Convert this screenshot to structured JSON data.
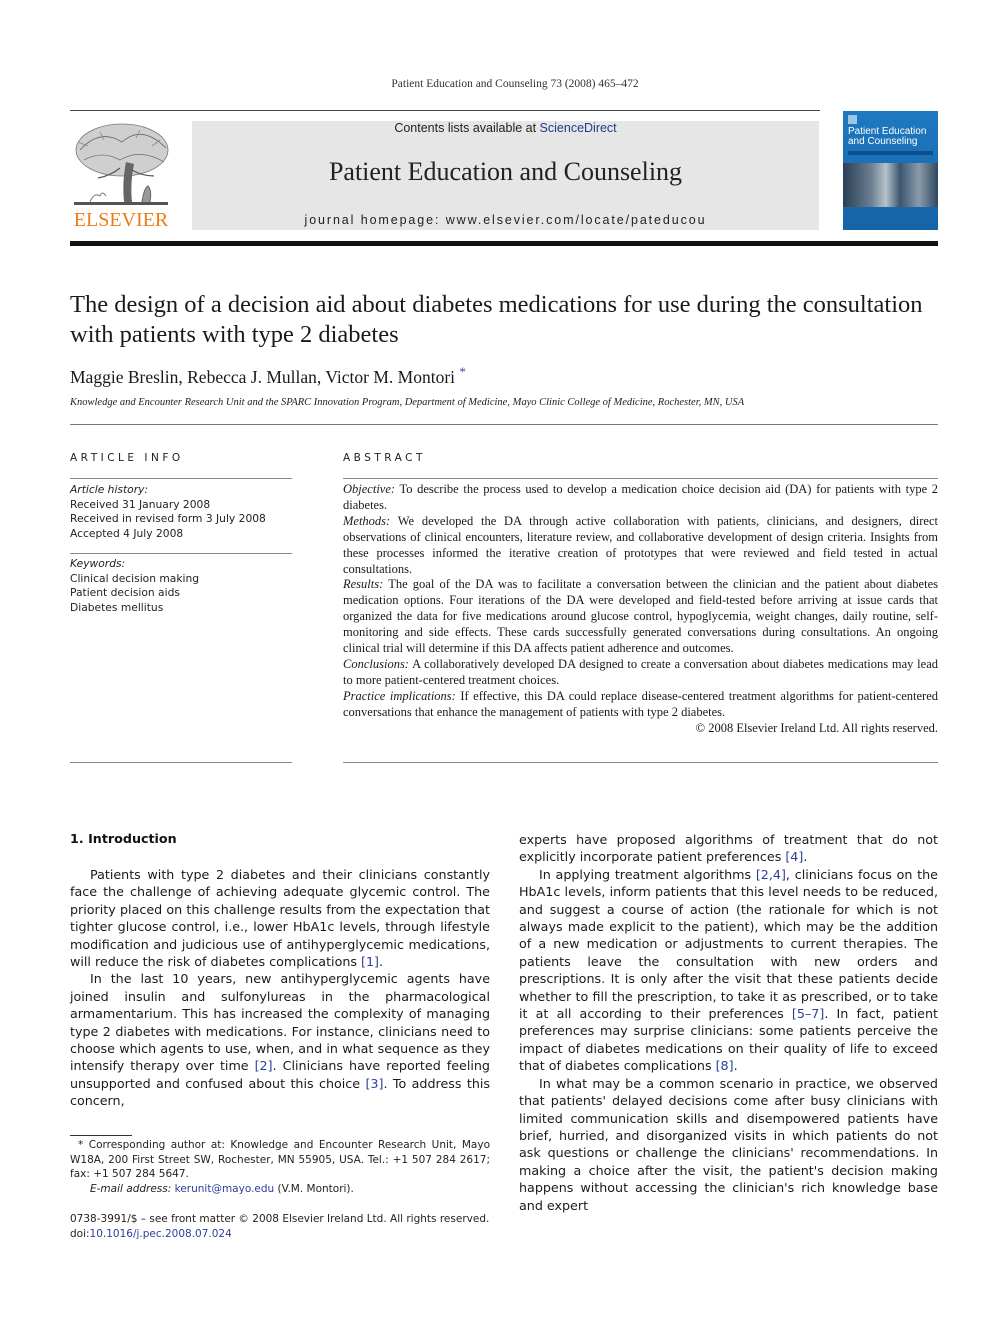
{
  "running_head": "Patient Education and Counseling 73 (2008) 465–472",
  "publisher": {
    "logo_icon": "elsevier-tree-icon",
    "name": "ELSEVIER",
    "brand_color": "#f07b17"
  },
  "banner": {
    "contents_prefix": "Contents lists available at ",
    "contents_link": "ScienceDirect",
    "journal_title": "Patient Education and Counseling",
    "homepage": "journal homepage: www.elsevier.com/locate/pateducou",
    "link_color": "#1f3b8f"
  },
  "cover": {
    "title_line1": "Patient Education",
    "title_line2": "and Counseling",
    "color": "#1f78c0"
  },
  "article": {
    "title": "The design of a decision aid about diabetes medications for use during the consultation with patients with type 2 diabetes",
    "authors": "Maggie Breslin, Rebecca J. Mullan, Victor M. Montori",
    "author_mark": "*",
    "affiliation": "Knowledge and Encounter Research Unit and the SPARC Innovation Program, Department of Medicine, Mayo Clinic College of Medicine, Rochester, MN, USA"
  },
  "article_info": {
    "heading": "ARTICLE INFO",
    "history_label": "Article history:",
    "history": [
      "Received 31 January 2008",
      "Received in revised form 3 July 2008",
      "Accepted 4 July 2008"
    ],
    "keywords_label": "Keywords:",
    "keywords": [
      "Clinical decision making",
      "Patient decision aids",
      "Diabetes mellitus"
    ]
  },
  "abstract": {
    "heading": "ABSTRACT",
    "sections": [
      {
        "label": "Objective:",
        "text": " To describe the process used to develop a medication choice decision aid (DA) for patients with type 2 diabetes."
      },
      {
        "label": "Methods:",
        "text": " We developed the DA through active collaboration with patients, clinicians, and designers, direct observations of clinical encounters, literature review, and collaborative development of design criteria. Insights from these processes informed the iterative creation of prototypes that were reviewed and field tested in actual consultations."
      },
      {
        "label": "Results:",
        "text": " The goal of the DA was to facilitate a conversation between the clinician and the patient about diabetes medication options. Four iterations of the DA were developed and field-tested before arriving at issue cards that organized the data for five medications around glucose control, hypoglycemia, weight changes, daily routine, self-monitoring and side effects. These cards successfully generated conversations during consultations. An ongoing clinical trial will determine if this DA affects patient adherence and outcomes."
      },
      {
        "label": "Conclusions:",
        "text": " A collaboratively developed DA designed to create a conversation about diabetes medications may lead to more patient-centered treatment choices."
      },
      {
        "label": "Practice implications:",
        "text": " If effective, this DA could replace disease-centered treatment algorithms for patient-centered conversations that enhance the management of patients with type 2 diabetes."
      }
    ],
    "copyright": "© 2008 Elsevier Ireland Ltd. All rights reserved."
  },
  "body": {
    "section_heading": "1. Introduction",
    "left_paragraphs": [
      {
        "parts": [
          "Patients with type 2 diabetes and their clinicians constantly face the challenge of achieving adequate glycemic control. The priority placed on this challenge results from the expectation that tighter glucose control, i.e., lower HbA1c levels, through lifestyle modification and judicious use of antihyperglycemic medications, will reduce the risk of diabetes complications ",
          "[1]",
          "."
        ]
      },
      {
        "parts": [
          "In the last 10 years, new antihyperglycemic agents have joined insulin and sulfonylureas in the pharmacological armamentarium. This has increased the complexity of managing type 2 diabetes with medications. For instance, clinicians need to choose which agents to use, when, and in what sequence as they intensify therapy over time ",
          "[2]",
          ". Clinicians have reported feeling unsupported and confused about this choice ",
          "[3]",
          ". To address this concern,"
        ]
      }
    ],
    "right_paragraphs": [
      {
        "parts": [
          "experts have proposed algorithms of treatment that do not explicitly incorporate patient preferences ",
          "[4]",
          "."
        ]
      },
      {
        "parts": [
          "In applying treatment algorithms ",
          "[2,4]",
          ", clinicians focus on the HbA1c levels, inform patients that this level needs to be reduced, and suggest a course of action (the rationale for which is not always made explicit to the patient), which may be the addition of a new medication or adjustments to current therapies. The patients leave the consultation with new orders and prescriptions. It is only after the visit that these patients decide whether to fill the prescription, to take it as prescribed, or to take it at all according to their preferences ",
          "[5–7]",
          ". In fact, patient preferences may surprise clinicians: some patients perceive the impact of diabetes medications on their quality of life to exceed that of diabetes complications ",
          "[8]",
          "."
        ]
      },
      {
        "parts": [
          "In what may be a common scenario in practice, we observed that patients' delayed decisions come after busy clinicians with limited communication skills and disempowered patients have brief, hurried, and disorganized visits in which patients do not ask questions or challenge the clinicians' recommendations. In making a choice after the visit, the patient's decision making happens without accessing the clinician's rich knowledge base and expert"
        ]
      }
    ]
  },
  "footnote": {
    "mark": "*",
    "text": " Corresponding author at: Knowledge and Encounter Research Unit, Mayo W18A, 200 First Street SW, Rochester, MN 55905, USA. Tel.: +1 507 284 2617; fax: +1 507 284 5647.",
    "email_label": "E-mail address:",
    "email": "kerunit@mayo.edu",
    "email_suffix": " (V.M. Montori)."
  },
  "front_matter": {
    "issn_line": "0738-3991/$ – see front matter © 2008 Elsevier Ireland Ltd. All rights reserved.",
    "doi_prefix": "doi:",
    "doi": "10.1016/j.pec.2008.07.024"
  }
}
